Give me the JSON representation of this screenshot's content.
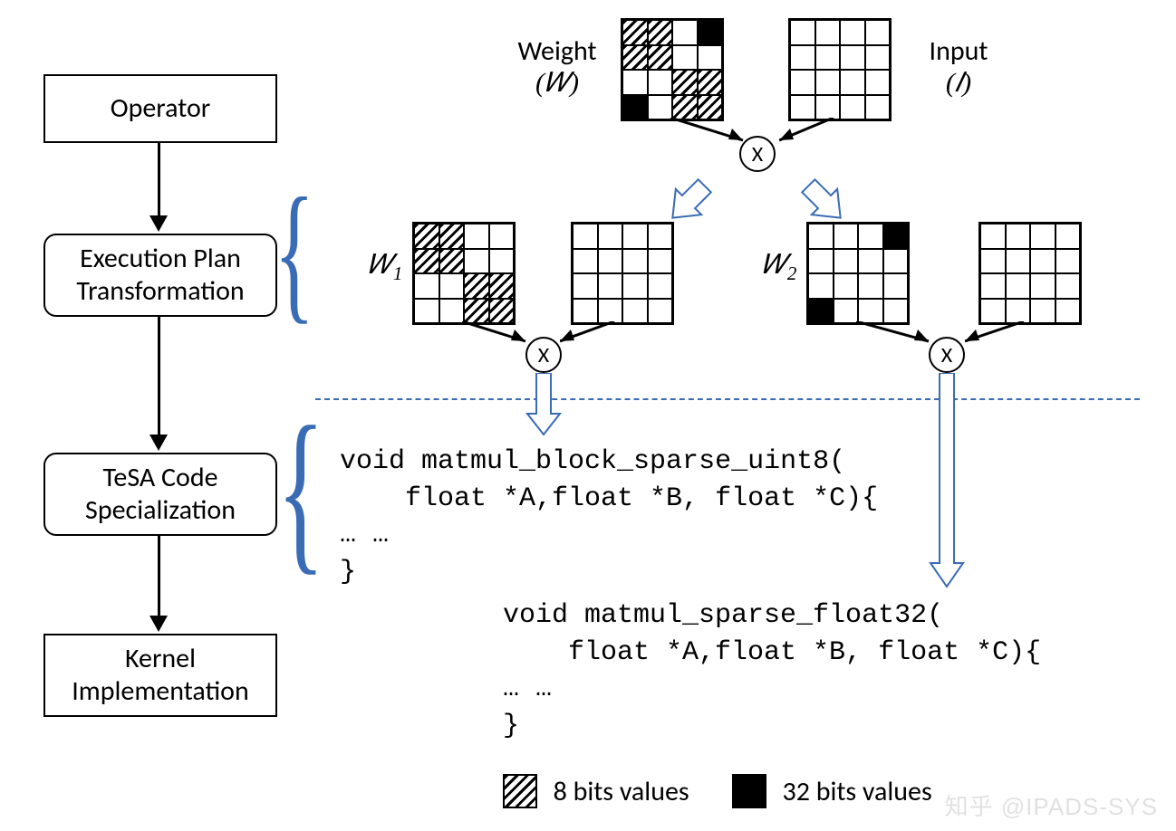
{
  "flow": {
    "operator": "Operator",
    "exec_plan": "Execution Plan\nTransformation",
    "tesa": "TeSA Code\nSpecialization",
    "kernel": "Kernel\nImplementation"
  },
  "labels": {
    "weight": "Weight",
    "weight_symbol": "(𝑊)",
    "input": "Input",
    "input_symbol": "(𝐼)",
    "w1": "𝑊",
    "w1_sub": "1",
    "w2": "𝑊",
    "w2_sub": "2",
    "mult": "X"
  },
  "code": {
    "fn1_sig": "void matmul_block_sparse_uint8(",
    "fn1_args": "    float *A,float *B, float *C){",
    "ellipsis": "… …",
    "close": "}",
    "fn2_sig": "void matmul_sparse_float32(",
    "fn2_args": "    float *A,float *B, float *C){"
  },
  "legend": {
    "l8": "8 bits values",
    "l32": "32 bits values"
  },
  "watermark": "知乎 @IPADS-SYS"
}
